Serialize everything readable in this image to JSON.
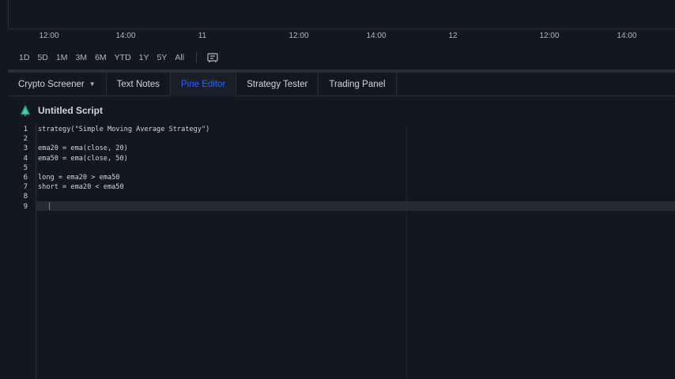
{
  "time_axis": {
    "ticks": [
      "12:00",
      "14:00",
      "11",
      "12:00",
      "14:00",
      "12",
      "12:00",
      "14:00"
    ]
  },
  "range_bar": {
    "buttons": [
      "1D",
      "5D",
      "1M",
      "3M",
      "6M",
      "YTD",
      "1Y",
      "5Y",
      "All"
    ],
    "compare_icon": "compare-icon"
  },
  "panel_tabs": {
    "crypto_screener": "Crypto Screener",
    "text_notes": "Text Notes",
    "pine_editor": "Pine Editor",
    "strategy_tester": "Strategy Tester",
    "trading_panel": "Trading Panel",
    "active": "Pine Editor"
  },
  "script": {
    "title": "Untitled Script",
    "icon": "pine-tree-icon"
  },
  "editor": {
    "line_numbers": [
      "1",
      "2",
      "3",
      "4",
      "5",
      "6",
      "7",
      "8",
      "9"
    ],
    "lines": [
      "strategy(\"Simple Moving Average Strategy\")",
      "",
      "ema20 = ema(close, 20)",
      "ema50 = ema(close, 50)",
      "",
      "long = ema20 > ema50",
      "short = ema20 < ema50",
      "",
      ""
    ],
    "active_line": 9
  },
  "colors": {
    "background": "#131722",
    "accent": "#2962ff",
    "text": "#d1d4dc",
    "pine_icon": "#26a69a"
  }
}
